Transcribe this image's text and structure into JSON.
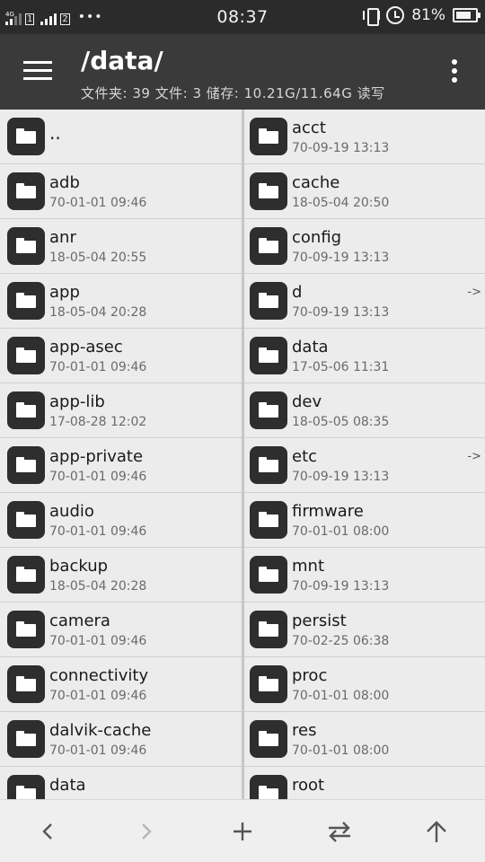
{
  "status_bar": {
    "network_label": "4G",
    "sim1_label": "1",
    "sim2_label": "2",
    "more_dots": "•••",
    "time": "08:37",
    "battery_percent": "81%",
    "battery_level": 0.81,
    "icons": [
      "signal-icon",
      "vibrate-icon",
      "alarm-icon",
      "battery-icon"
    ]
  },
  "header": {
    "path": "/data/",
    "info": "文件夹: 39  文件: 3  储存: 10.21G/11.64G  读写",
    "icons": [
      "menu-icon",
      "more-vert-icon"
    ]
  },
  "left_panel": {
    "items": [
      {
        "name": "..",
        "date": ""
      },
      {
        "name": "adb",
        "date": "70-01-01 09:46"
      },
      {
        "name": "anr",
        "date": "18-05-04 20:55"
      },
      {
        "name": "app",
        "date": "18-05-04 20:28"
      },
      {
        "name": "app-asec",
        "date": "70-01-01 09:46"
      },
      {
        "name": "app-lib",
        "date": "17-08-28 12:02"
      },
      {
        "name": "app-private",
        "date": "70-01-01 09:46"
      },
      {
        "name": "audio",
        "date": "70-01-01 09:46"
      },
      {
        "name": "backup",
        "date": "18-05-04 20:28"
      },
      {
        "name": "camera",
        "date": "70-01-01 09:46"
      },
      {
        "name": "connectivity",
        "date": "70-01-01 09:46"
      },
      {
        "name": "dalvik-cache",
        "date": "70-01-01 09:46"
      },
      {
        "name": "data",
        "date": ""
      }
    ]
  },
  "right_panel": {
    "items": [
      {
        "name": "acct",
        "date": "70-09-19 13:13",
        "link": ""
      },
      {
        "name": "cache",
        "date": "18-05-04 20:50",
        "link": ""
      },
      {
        "name": "config",
        "date": "70-09-19 13:13",
        "link": ""
      },
      {
        "name": "d",
        "date": "70-09-19 13:13",
        "link": "->"
      },
      {
        "name": "data",
        "date": "17-05-06 11:31",
        "link": ""
      },
      {
        "name": "dev",
        "date": "18-05-05 08:35",
        "link": ""
      },
      {
        "name": "etc",
        "date": "70-09-19 13:13",
        "link": "->"
      },
      {
        "name": "firmware",
        "date": "70-01-01 08:00",
        "link": ""
      },
      {
        "name": "mnt",
        "date": "70-09-19 13:13",
        "link": ""
      },
      {
        "name": "persist",
        "date": "70-02-25 06:38",
        "link": ""
      },
      {
        "name": "proc",
        "date": "70-01-01 08:00",
        "link": ""
      },
      {
        "name": "res",
        "date": "70-01-01 08:00",
        "link": ""
      },
      {
        "name": "root",
        "date": "",
        "link": ""
      }
    ]
  },
  "bottom_bar": {
    "buttons": [
      {
        "name": "back-button",
        "icon": "chevron-left-icon",
        "enabled": true
      },
      {
        "name": "forward-button",
        "icon": "chevron-right-icon",
        "enabled": false
      },
      {
        "name": "add-button",
        "icon": "plus-icon",
        "enabled": true
      },
      {
        "name": "swap-panels-button",
        "icon": "swap-icon",
        "enabled": true
      },
      {
        "name": "up-button",
        "icon": "arrow-up-icon",
        "enabled": true
      }
    ]
  },
  "colors": {
    "status_bar": "#2b2b2b",
    "header": "#3a3a3a",
    "list_background": "#ececec",
    "folder_icon": "#2e2e2e",
    "disabled_icon": "#b5b5b5",
    "enabled_icon": "#555555"
  }
}
